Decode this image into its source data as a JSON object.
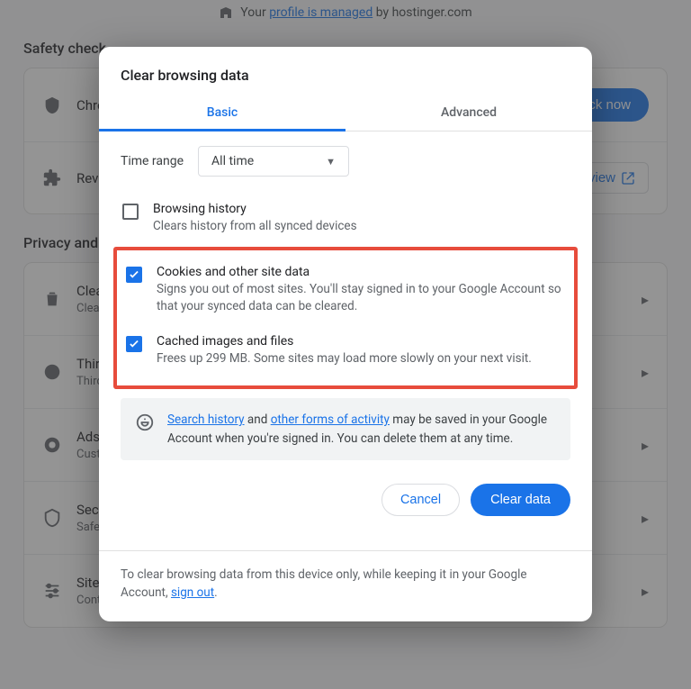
{
  "banner": {
    "prefix": "Your ",
    "link": "profile is managed",
    "suffix": " by hostinger.com"
  },
  "sections": {
    "safety_title": "Safety check",
    "privacy_title": "Privacy and security"
  },
  "safety": {
    "row1_label": "Chrome can help keep you safe",
    "check_now": "Check now",
    "row2_label": "Review",
    "review": "Review"
  },
  "privacy_rows": [
    {
      "title": "Clear browsing data",
      "sub": "Clear history, cookies, cache, and more"
    },
    {
      "title": "Third-party cookies",
      "sub": "Third-party cookies are blocked"
    },
    {
      "title": "Ads privacy",
      "sub": "Customize the info used by sites to show you ads"
    },
    {
      "title": "Security",
      "sub": "Safe Browsing and other security settings"
    },
    {
      "title": "Site settings",
      "sub": "Controls what information sites can use"
    }
  ],
  "dialog": {
    "title": "Clear browsing data",
    "tabs": {
      "basic": "Basic",
      "advanced": "Advanced"
    },
    "time_range_label": "Time range",
    "time_range_value": "All time",
    "options": [
      {
        "title": "Browsing history",
        "desc": "Clears history from all synced devices",
        "checked": false
      },
      {
        "title": "Cookies and other site data",
        "desc": "Signs you out of most sites. You'll stay signed in to your Google Account so that your synced data can be cleared.",
        "checked": true
      },
      {
        "title": "Cached images and files",
        "desc": "Frees up 299 MB. Some sites may load more slowly on your next visit.",
        "checked": true
      }
    ],
    "info": {
      "p1_link1": "Search history",
      "p1_mid": " and ",
      "p1_link2": "other forms of activity",
      "p1_tail": " may be saved in your Google Account when you're signed in. You can delete them at any time."
    },
    "actions": {
      "cancel": "Cancel",
      "clear": "Clear data"
    },
    "footer": {
      "text": "To clear browsing data from this device only, while keeping it in your Google Account, ",
      "link": "sign out",
      "tail": "."
    }
  }
}
